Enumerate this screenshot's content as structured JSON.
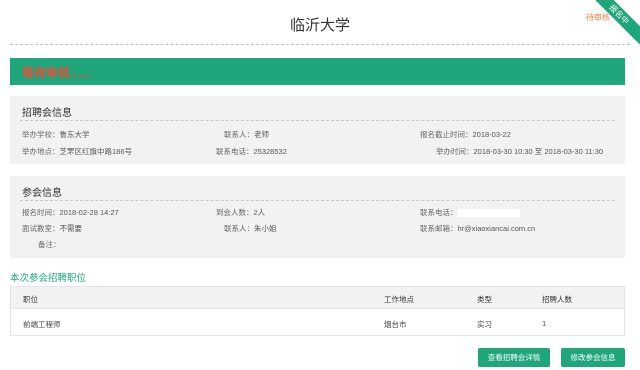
{
  "header": {
    "school_name": "临沂大学",
    "status": "待审核",
    "ribbon": "报名中"
  },
  "banner": {
    "text": "等待审核......"
  },
  "fair_info": {
    "title": "招聘会信息",
    "host_school_label": "举办学校：",
    "host_school": "鲁东大学",
    "contact_label": "联系人：",
    "contact": "老师",
    "deadline_label": "报名截止时间：",
    "deadline": "2018-03-22",
    "location_label": "举办地点：",
    "location": "芝罘区红旗中路186号",
    "phone_label": "联系电话：",
    "phone": "25328532",
    "time_label": "举办时间：",
    "time": "2018-03-30 10:30 至 2018-03-30 11:30"
  },
  "participation_info": {
    "title": "参会信息",
    "signup_time_label": "报名时间：",
    "signup_time": "2018-02-28 14:27",
    "attendees_label": "到会人数：",
    "attendees": "2人",
    "phone_label": "联系电话：",
    "interview_room_label": "面试教室：",
    "interview_room": "不需要",
    "contact_label": "联系人：",
    "contact": "朱小姐",
    "email_label": "联系邮箱：",
    "email": "hr@xiaoxiancai.com.cn",
    "remarks_label": "备注："
  },
  "positions": {
    "title": "本次参会招聘职位",
    "columns": [
      "职位",
      "工作地点",
      "类型",
      "招聘人数"
    ],
    "rows": [
      {
        "position": "前端工程师",
        "location": "烟台市",
        "type": "实习",
        "count": "1"
      }
    ]
  },
  "actions": {
    "view_details": "查看招聘会详情",
    "edit_info": "修改参会信息"
  },
  "colors": {
    "accent": "#1fa67a",
    "warning": "#e0533c",
    "status": "#ff7a45"
  }
}
